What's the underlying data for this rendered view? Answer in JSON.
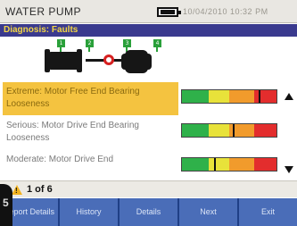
{
  "header": {
    "app_title": "WATER PUMP",
    "datetime": "10/04/2010 10:32 PM",
    "battery_icon": "battery-icon"
  },
  "subheader": {
    "title": "Diagnosis: Faults"
  },
  "diagram": {
    "points": [
      "1",
      "2",
      "3",
      "4"
    ],
    "icon": "machine-train-icon"
  },
  "faults": [
    {
      "text": "Extreme: Motor Free End Bearing Looseness",
      "severity_level": 0.82,
      "selected": true
    },
    {
      "text": "Serious: Motor Drive End Bearing Looseness",
      "severity_level": 0.55,
      "selected": false
    },
    {
      "text": "Moderate: Motor Drive End",
      "severity_level": 0.35,
      "selected": false
    }
  ],
  "severity_colors": {
    "green": "#2fb14a",
    "yellow": "#e8e23a",
    "orange": "#f19b2c",
    "red": "#e32d2d"
  },
  "status": {
    "page_count": "1 of 6",
    "warning_icon": "warning-icon"
  },
  "softkeys": [
    {
      "label": "Report Details"
    },
    {
      "label": "History"
    },
    {
      "label": "Details"
    },
    {
      "label": "Next"
    },
    {
      "label": "Exit"
    }
  ],
  "bezel_label": "5"
}
